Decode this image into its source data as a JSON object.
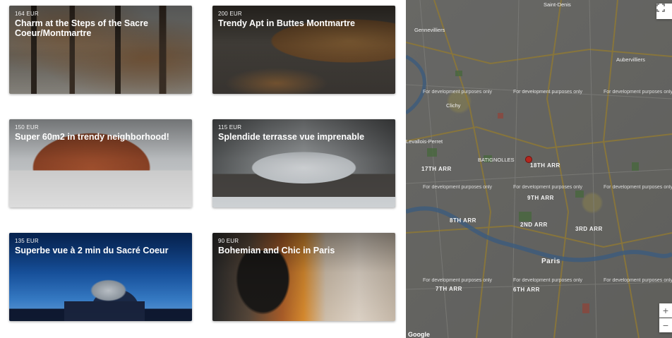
{
  "listings": [
    {
      "price": "164 EUR",
      "title": "Charm at the Steps of the Sacre Coeur/Montmartre"
    },
    {
      "price": "200 EUR",
      "title": "Trendy Apt in Buttes Montmartre"
    },
    {
      "price": "150 EUR",
      "title": "Super 60m2 in trendy neighborhood!"
    },
    {
      "price": "115 EUR",
      "title": "Splendide terrasse vue imprenable"
    },
    {
      "price": "135 EUR",
      "title": "Superbe vue à 2 min du Sacré Coeur"
    },
    {
      "price": "90 EUR",
      "title": "Bohemian and Chic in Paris"
    }
  ],
  "map": {
    "watermark": "For development purposes only",
    "areas": [
      "18TH ARR",
      "17TH ARR",
      "9TH ARR",
      "8TH ARR",
      "2ND ARR",
      "3RD ARR",
      "7TH ARR",
      "6TH ARR",
      "Paris"
    ],
    "places": [
      "Saint-Denis",
      "Aubervilliers",
      "Clichy",
      "Gennevilliers",
      "Levallois-Perret",
      "BATIGNOLLES"
    ],
    "google_label": "Google",
    "fullscreen_icon": "fullscreen-icon",
    "zoom_in": "+",
    "zoom_out": "−"
  }
}
